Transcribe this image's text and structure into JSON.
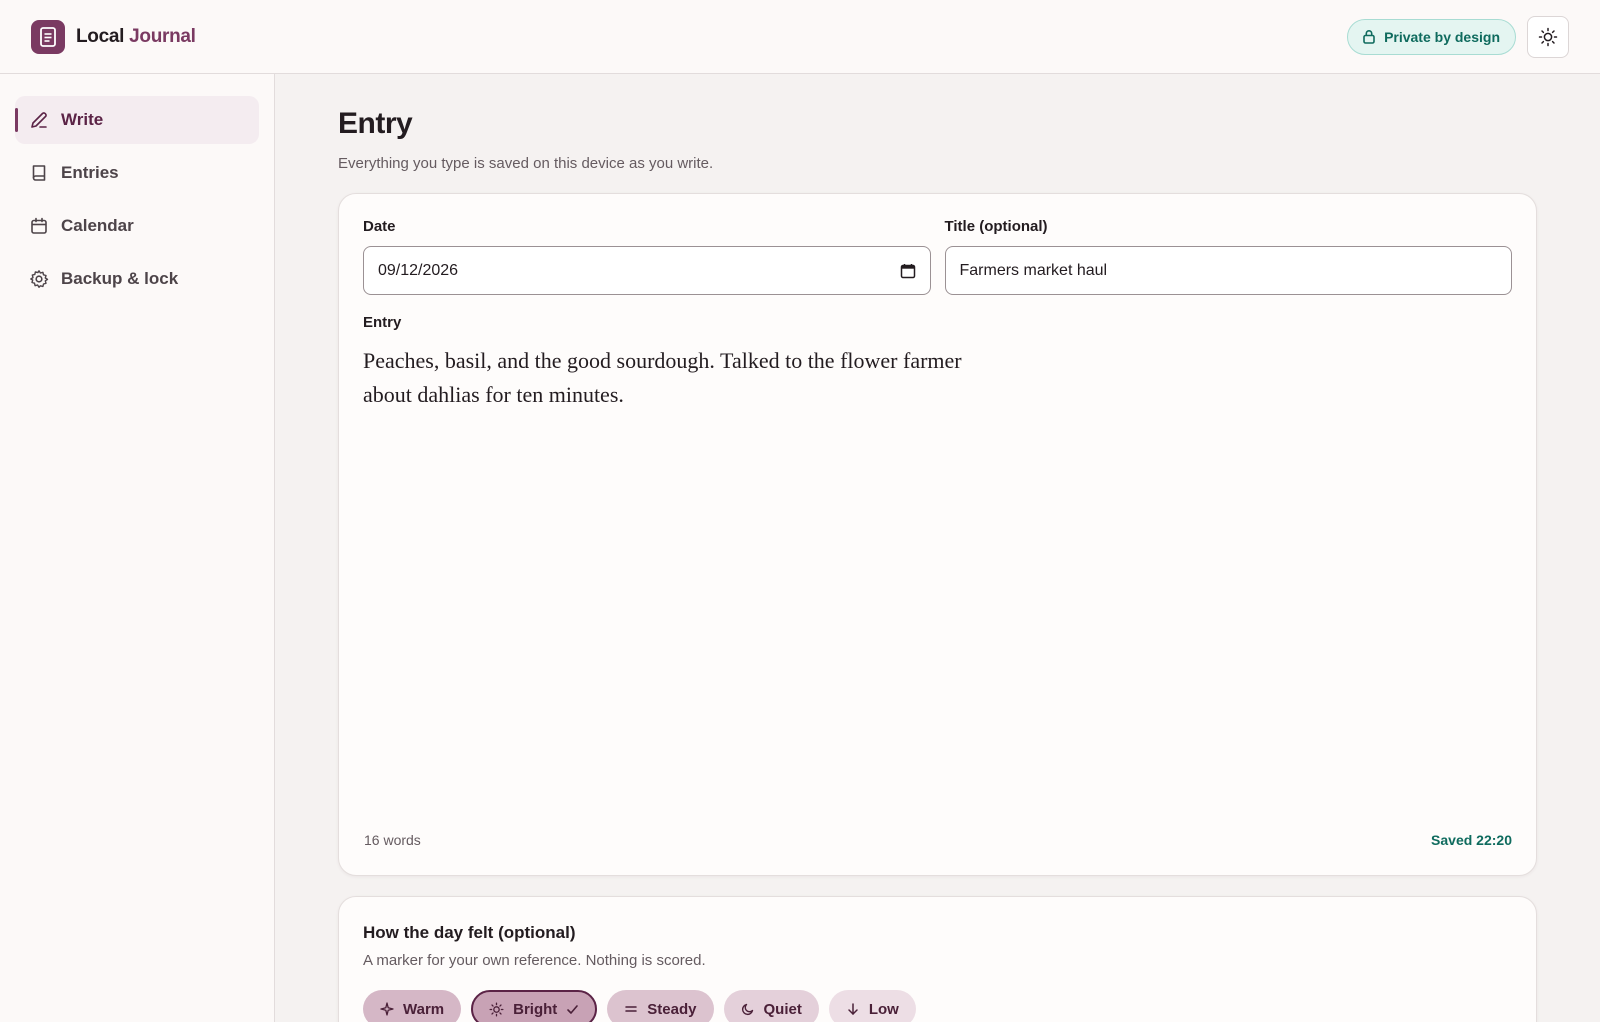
{
  "app": {
    "name_part1": "Local",
    "name_part2": "Journal",
    "privacy_badge": "Private by design",
    "accent_color": "#7a3a62",
    "privacy_color": "#0f6b5e"
  },
  "sidebar": {
    "items": [
      {
        "label": "Write",
        "icon": "pencil-icon",
        "active": true
      },
      {
        "label": "Entries",
        "icon": "book-icon",
        "active": false
      },
      {
        "label": "Calendar",
        "icon": "calendar-icon",
        "active": false
      },
      {
        "label": "Backup & lock",
        "icon": "gear-icon",
        "active": false
      }
    ]
  },
  "page": {
    "title": "Entry",
    "subtitle": "Everything you type is saved on this device as you write."
  },
  "entry_form": {
    "date_label": "Date",
    "date_value": "09/12/2026",
    "title_label": "Title (optional)",
    "title_value": "Farmers market haul",
    "entry_label": "Entry",
    "entry_text": "Peaches, basil, and the good sourdough. Talked to the flower farmer about dahlias for ten minutes.",
    "word_count": "16 words",
    "saved_status": "Saved 22:20"
  },
  "mood": {
    "title": "How the day felt (optional)",
    "subtitle": "A marker for your own reference. Nothing is scored.",
    "chips": [
      {
        "label": "Warm",
        "icon": "sparkle-icon",
        "selected": false
      },
      {
        "label": "Bright",
        "icon": "sun-icon",
        "selected": true
      },
      {
        "label": "Steady",
        "icon": "equals-icon",
        "selected": false
      },
      {
        "label": "Quiet",
        "icon": "moon-icon",
        "selected": false
      },
      {
        "label": "Low",
        "icon": "arrow-down-icon",
        "selected": false
      }
    ]
  }
}
